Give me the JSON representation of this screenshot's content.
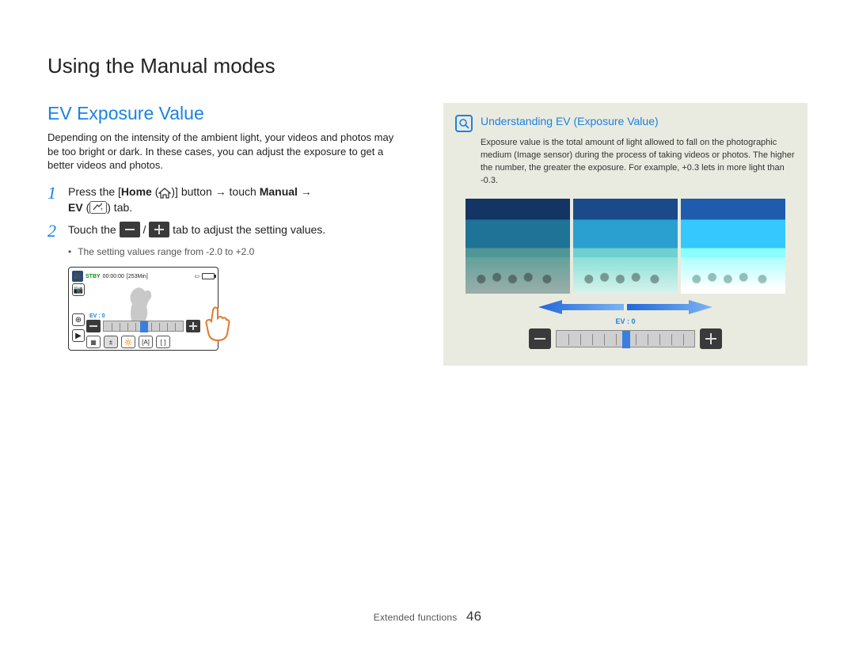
{
  "page": {
    "title": "Using the Manual modes",
    "footer_section": "Extended functions",
    "page_number": "46"
  },
  "left": {
    "heading": "EV Exposure Value",
    "intro": "Depending on the intensity of the ambient light, your videos and photos may be too bright or dark. In these cases, you can adjust the exposure to get a better videos and photos.",
    "step1_a": "Press the [",
    "step1_home": "Home",
    "step1_b": " (",
    "step1_c": ")] button → touch ",
    "step1_manual": "Manual",
    "step1_d": " → ",
    "step1_ev": "EV",
    "step1_e": " (",
    "step1_f": ") tab.",
    "step2_a": "Touch the ",
    "step2_b": " / ",
    "step2_c": " tab to adjust the setting values.",
    "bullet": "The setting values range from -2.0 to +2.0"
  },
  "lcd": {
    "stby": "STBY",
    "time": "00:00:00",
    "remain": "[253Min]",
    "ev_label": "EV :",
    "ev_value": "0"
  },
  "right": {
    "callout_title": "Understanding EV (Exposure Value)",
    "callout_para": "Exposure value is the total amount of light allowed to fall on the photographic medium (Image sensor) during the process of taking videos or photos. The higher the number, the greater the exposure. For example, +0.3 lets in more light than -0.3.",
    "ev_label": "EV :",
    "ev_value": "0"
  }
}
